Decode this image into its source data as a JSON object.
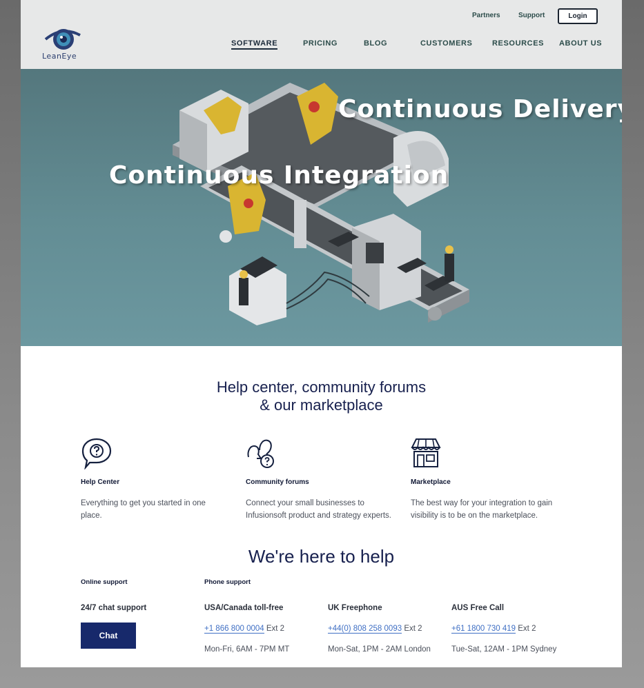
{
  "header": {
    "logo_text": "LeanEye",
    "utility": {
      "partners": "Partners",
      "support": "Support",
      "login": "Login"
    },
    "nav": [
      "SOFTWARE",
      "PRICING",
      "BLOG",
      "CUSTOMERS",
      "RESOURCES",
      "ABOUT US"
    ],
    "active_nav": "SOFTWARE"
  },
  "hero": {
    "title_top": "Continuous Delivery",
    "title_bottom": "Continuous Integration"
  },
  "resources": {
    "title_line1": "Help center, community forums",
    "title_line2": "& our marketplace",
    "items": [
      {
        "icon": "question-bubble-icon",
        "title": "Help Center",
        "description": "Everything to get you started in one place."
      },
      {
        "icon": "community-icon",
        "title": "Community forums",
        "description": "Connect your small businesses to Infusionsoft product and strategy experts."
      },
      {
        "icon": "storefront-icon",
        "title": "Marketplace",
        "description": "The best way for your integration to gain visibility is to be on the marketplace."
      }
    ]
  },
  "help": {
    "title": "We're here to help",
    "online_label": "Online support",
    "phone_label": "Phone support",
    "chat_heading": "24/7 chat support",
    "chat_button": "Chat",
    "regions": [
      {
        "name": "USA/Canada toll-free",
        "number": "+1 866 800 0004",
        "ext": "Ext 2",
        "hours": "Mon-Fri, 6AM - 7PM MT"
      },
      {
        "name": "UK Freephone",
        "number": "+44(0) 808 258 0093",
        "ext": "Ext 2",
        "hours": "Mon-Sat, 1PM - 2AM London"
      },
      {
        "name": "AUS Free Call",
        "number": "+61 1800 730 419",
        "ext": "Ext 2",
        "hours": "Tue-Sat, 12AM - 1PM Sydney"
      }
    ]
  },
  "colors": {
    "navy": "#17296b",
    "heading": "#17204e",
    "link": "#3f6fc4",
    "hero": "#638d94"
  }
}
